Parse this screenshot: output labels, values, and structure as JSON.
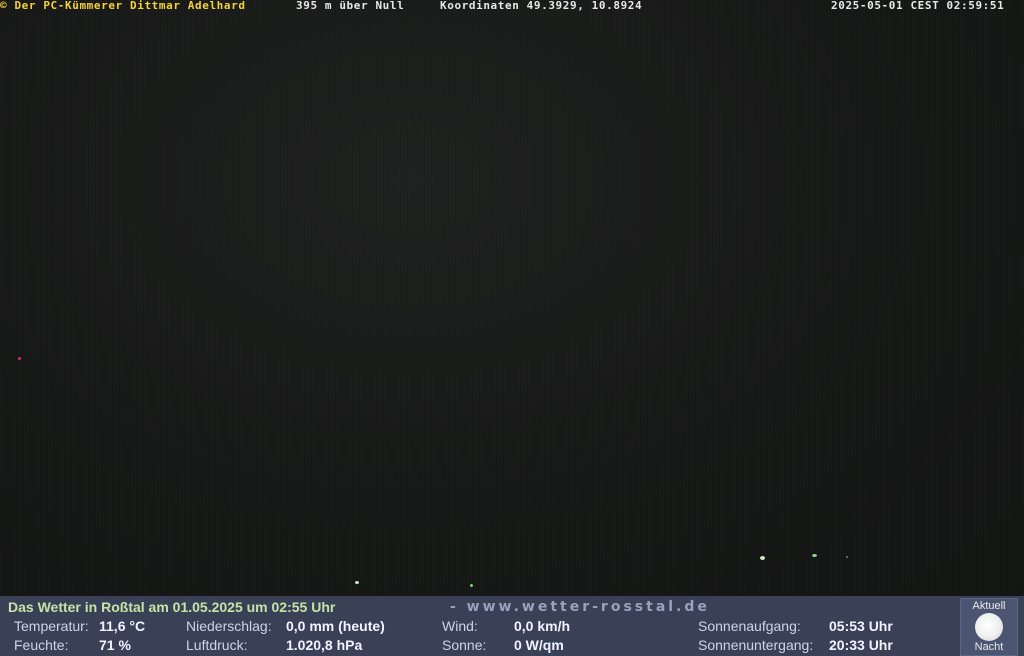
{
  "overlay": {
    "copyright": "© Der PC-Kümmerer Dittmar Adelhard",
    "altitude": "395 m über Null",
    "coordinates": "Koordinaten 49.3929, 10.8924",
    "timestamp": "2025-05-01 CEST 02:59:51"
  },
  "weather": {
    "title": "Das Wetter in Roßtal am 01.05.2025 um 02:55 Uhr",
    "url": "- www.wetter-rosstal.de",
    "temperature_label": "Temperatur:",
    "temperature_value": "11,6 °C",
    "humidity_label": "Feuchte:",
    "humidity_value": "71 %",
    "precip_label": "Niederschlag:",
    "precip_value": "0,0 mm (heute)",
    "pressure_label": "Luftdruck:",
    "pressure_value": "1.020,8 hPa",
    "wind_label": "Wind:",
    "wind_value": "0,0 km/h",
    "sun_label": "Sonne:",
    "sun_value": "0 W/qm",
    "sunrise_label": "Sonnenaufgang:",
    "sunrise_value": "05:53 Uhr",
    "sunset_label": "Sonnenuntergang:",
    "sunset_value": "20:33 Uhr"
  },
  "moon": {
    "top_label": "Aktuell",
    "bottom_label": "Nacht",
    "icon": "full-moon-icon"
  }
}
